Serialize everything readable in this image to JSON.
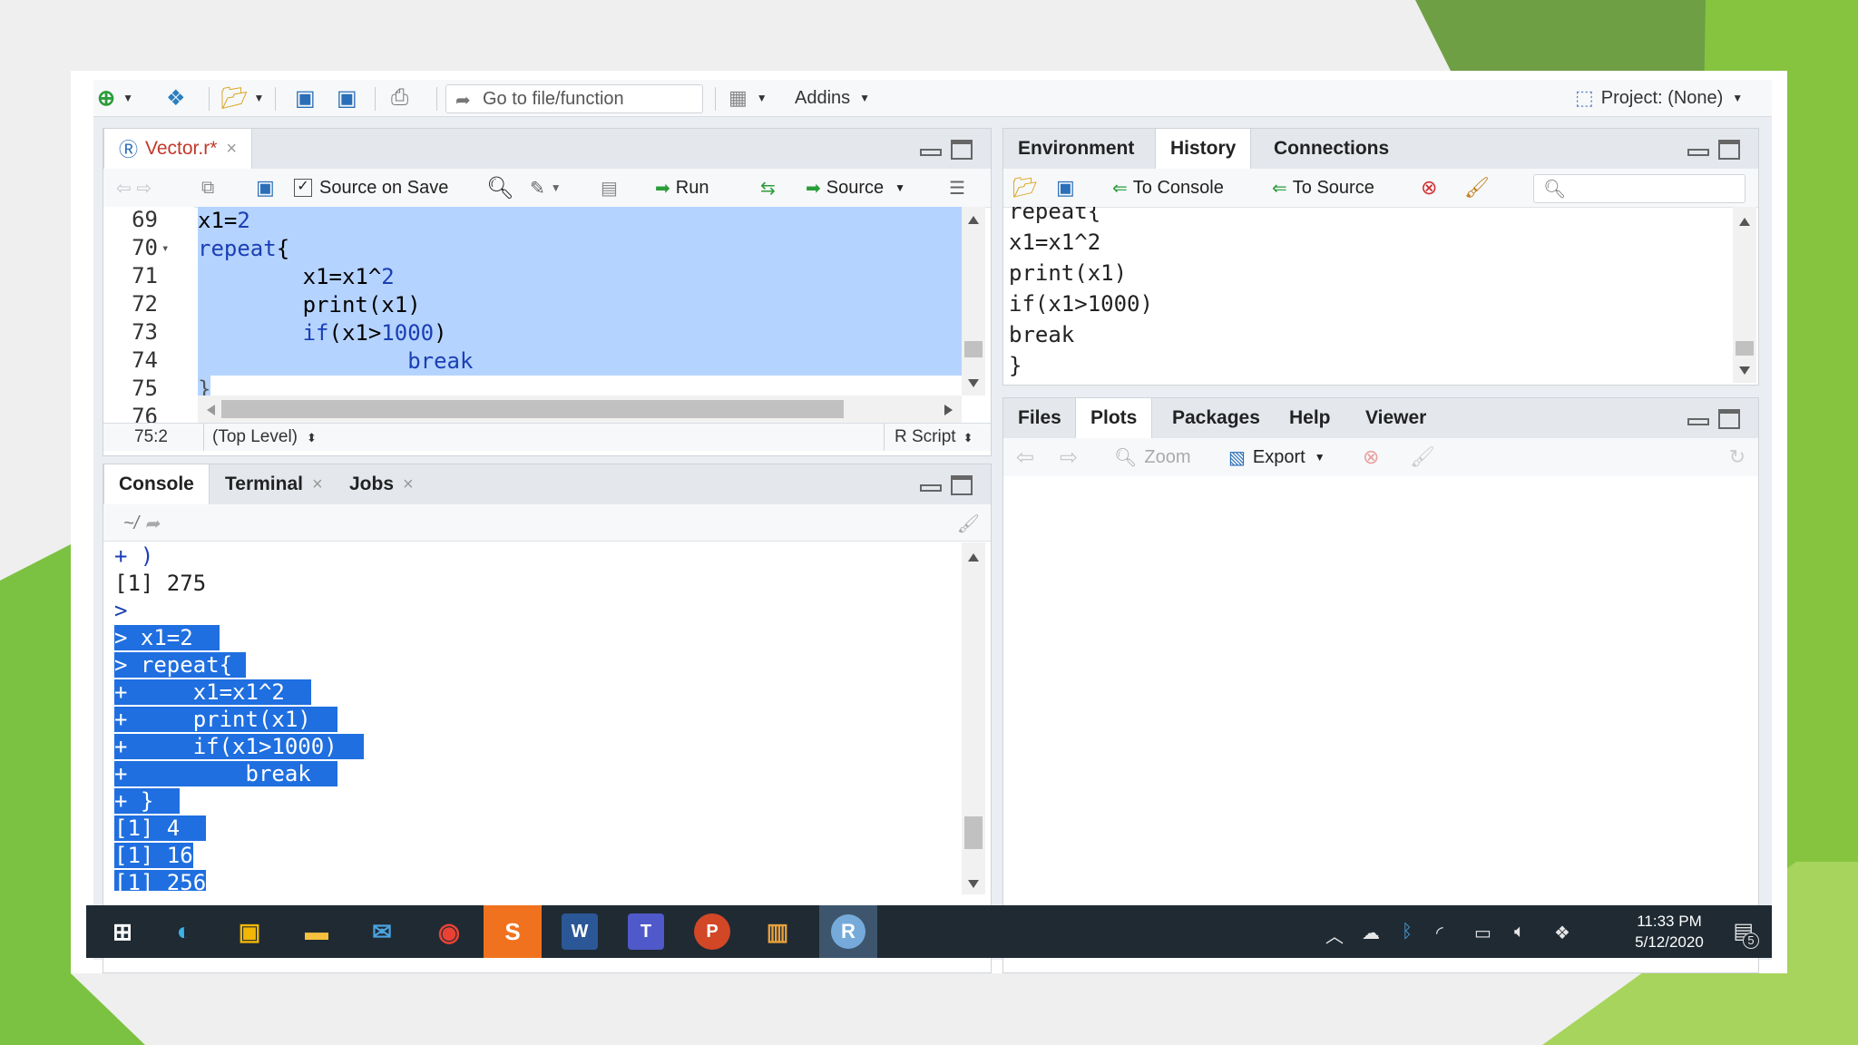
{
  "toolbar": {
    "goto_placeholder": "Go to file/function",
    "addins_label": "Addins",
    "project_label": "Project: (None)"
  },
  "editor": {
    "tab_label": "Vector.r*",
    "source_on_save_label": "Source on Save",
    "run_label": "Run",
    "source_label": "Source",
    "line_numbers": [
      "69",
      "70",
      "71",
      "72",
      "73",
      "74",
      "75",
      "76"
    ],
    "status_position": "75:2",
    "status_scope": "(Top Level)",
    "status_type": "R Script"
  },
  "console": {
    "tabs": [
      "Console",
      "Terminal",
      "Jobs"
    ],
    "path": "~/",
    "lines": [
      "+ )",
      "[1] 275",
      ">",
      "> x1=2",
      "> repeat{",
      "+     x1=x1^2",
      "+     print(x1)",
      "+     if(x1>1000)",
      "+         break",
      "+ }",
      "[1] 4",
      "[1] 16",
      "[1] 256"
    ]
  },
  "env_pane": {
    "tabs": [
      "Environment",
      "History",
      "Connections"
    ],
    "to_console_label": "To Console",
    "to_source_label": "To Source",
    "history_lines": [
      "repeat{",
      "x1=x1^2",
      "print(x1)",
      "if(x1>1000)",
      "break",
      "}"
    ]
  },
  "files_pane": {
    "tabs": [
      "Files",
      "Plots",
      "Packages",
      "Help",
      "Viewer"
    ],
    "zoom_label": "Zoom",
    "export_label": "Export"
  },
  "taskbar": {
    "r_label": "R",
    "time": "11:33 PM",
    "date": "5/12/2020",
    "notification_count": "5"
  },
  "colors": {
    "selection": "#b5d3ff",
    "console_selection": "#1f6fe0",
    "keyword": "#1a3fb3",
    "slide_green": "#7cc242"
  }
}
